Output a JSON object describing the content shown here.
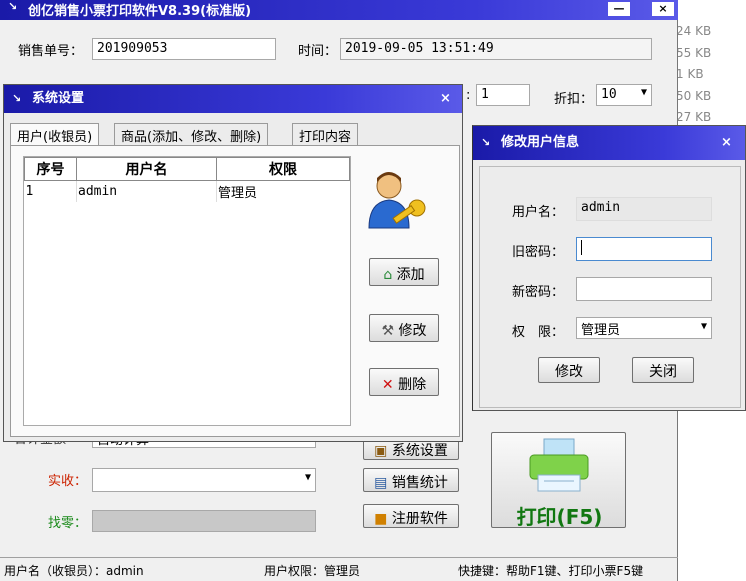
{
  "main_window": {
    "title": "创亿销售小票打印软件V8.39(标准版)",
    "order_no_label": "销售单号：",
    "order_no_value": "201909053",
    "time_label": "时间：",
    "time_value": "2019-09-05 13:51:49",
    "qty_value": "1",
    "discount_label": "折扣：",
    "discount_value": "10",
    "paid_label": "实收：",
    "change_label": "找零：",
    "partial_label": "合计金额",
    "partial_value": "自动计算",
    "btn_settings": "系统设置",
    "btn_stats": "销售统计",
    "btn_register": "注册软件",
    "btn_print": "打印(F5)"
  },
  "bg_file_sizes": [
    "24 KB",
    "55 KB",
    "1 KB",
    "50 KB",
    "27 KB"
  ],
  "status_bar": {
    "user": "用户名（收银员）：admin",
    "permission": "用户权限：管理员",
    "shortcuts": "快捷键：帮助F1键、打印小票F5键"
  },
  "settings_dialog": {
    "title": "系统设置",
    "tabs": [
      "用户(收银员)",
      "商品(添加、修改、删除)",
      "打印内容"
    ],
    "columns": [
      "序号",
      "用户名",
      "权限"
    ],
    "rows": [
      {
        "id": "1",
        "name": "admin",
        "role": "管理员"
      }
    ],
    "btn_add": "添加",
    "btn_edit": "修改",
    "btn_delete": "删除"
  },
  "edit_user_dialog": {
    "title": "修改用户信息",
    "username_label": "用户名：",
    "username_value": "admin",
    "old_pwd_label": "旧密码：",
    "new_pwd_label": "新密码：",
    "role_label": "权　限：",
    "role_value": "管理员",
    "btn_edit": "修改",
    "btn_close": "关闭"
  },
  "colors": {
    "titlebar": "#2a2ac0",
    "change_label": "#1a8a1a",
    "paid_label": "#cc2200",
    "print_text": "#117711"
  }
}
